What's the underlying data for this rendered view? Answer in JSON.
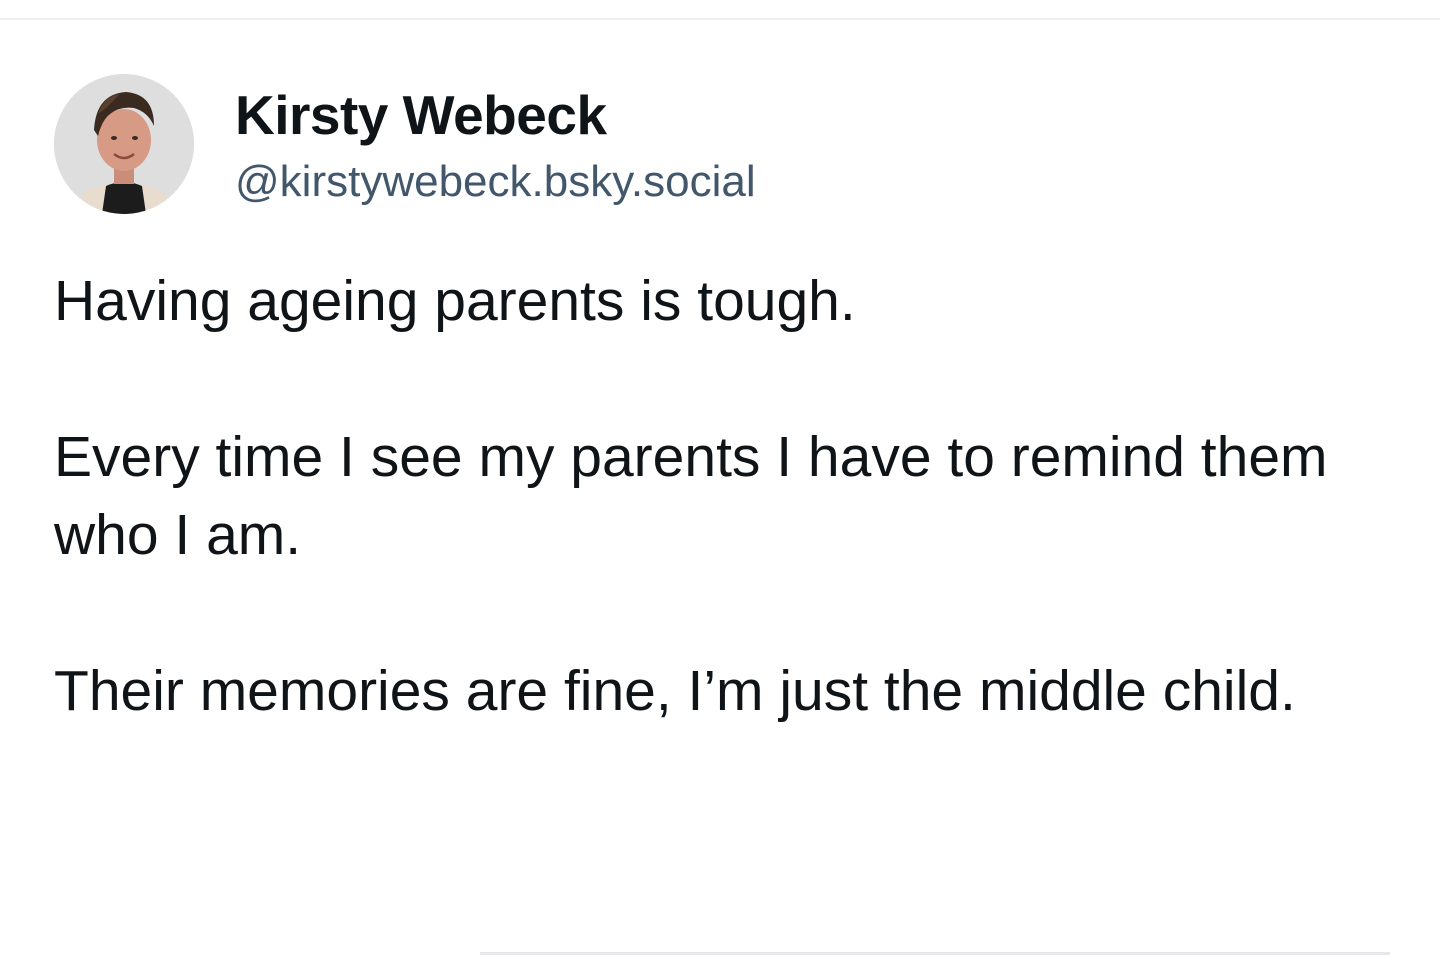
{
  "author": {
    "display_name": "Kirsty Webeck",
    "handle": "@kirstywebeck.bsky.social",
    "avatar_icon": "person-avatar-photo"
  },
  "post": {
    "paragraphs": [
      "Having ageing parents is tough.",
      "Every time I see my parents I have to remind them who I am.",
      "Their memories are fine, I’m just the middle child."
    ]
  },
  "colors": {
    "text_primary": "#0f1419",
    "text_secondary": "#42576c",
    "divider": "#eeeff1",
    "background": "#ffffff"
  }
}
